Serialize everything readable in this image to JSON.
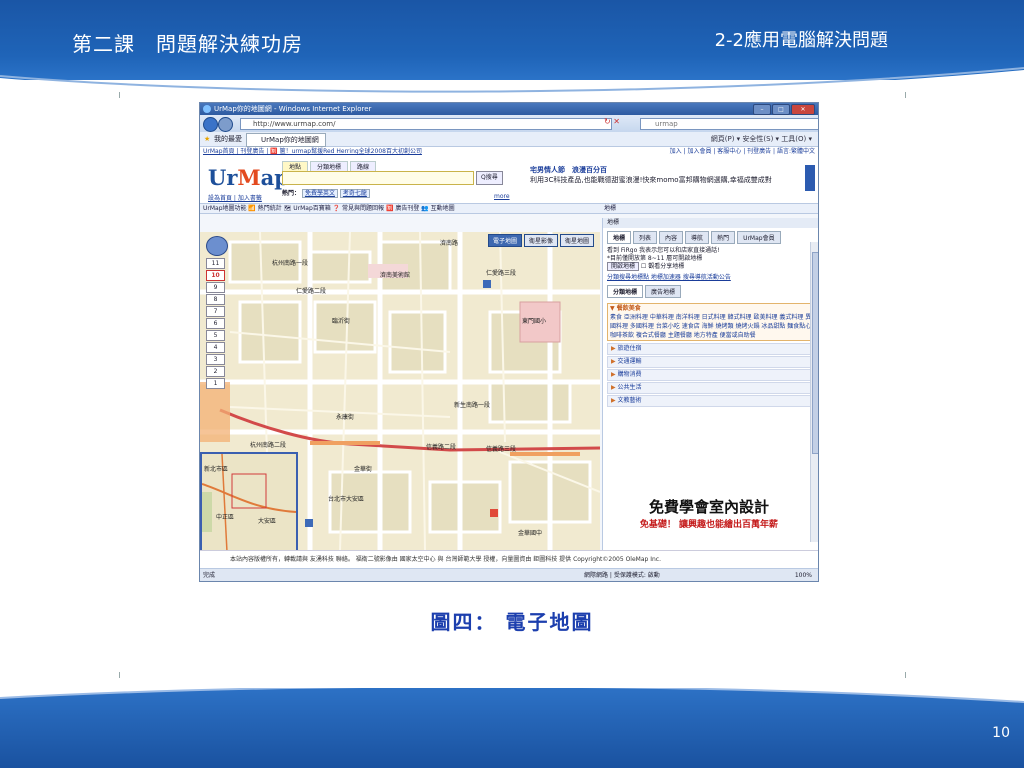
{
  "slide": {
    "lesson_title": "第二課　問題解決練功房",
    "section_title": "2-2應用電腦解決問題",
    "caption": "圖四：  電子地圖",
    "page_number": "10",
    "colors": {
      "header_blue": "#1f64b8",
      "caption_blue": "#1c3fae"
    }
  },
  "browser": {
    "window_title": "UrMap你的地圖網 - Windows Internet Explorer",
    "address": "http://www.urmap.com/",
    "search_placeholder": "urmap",
    "favorites_label": "我的最愛",
    "tab_title": "UrMap你的地圖網",
    "toolbar_right": "網頁(P) ▾  安全性(S) ▾  工具(O) ▾",
    "status_done": "完成",
    "status_zone": "網際網路 | 受保護模式: 啟動",
    "zoom_level": "100%"
  },
  "site": {
    "links_left": "UrMap首頁 | 刊登廣告 | 🈹 篋！urmap幫援Red Herring全球2008百大初創公司",
    "links_right": "加入 | 加入會員 | 客服中心 | 刊登廣告 | 語言:繁體中文",
    "logo_prefix": "Ur",
    "logo_accent": "M",
    "logo_suffix": "ap",
    "logo_links": "設為首頁 | 加入書籤",
    "search_tabs": [
      "地點",
      "分類地標",
      "路線"
    ],
    "search_button": "Q搜尋",
    "hot_label": "熱門：",
    "hot_1": "免費學英文",
    "hot_2": "考奇七龍",
    "more_link": "more",
    "ad_title": "宅男情人節　浪漫百分百",
    "ad_text": "利用3C科技產品,也能戰德甜蜜浪漫!快來momo富邦購物網選購,幸福成雙成對",
    "map_toolbar": "UrMap地圖功能  📶 熱門統計  🗺 UrMap百寶箱  ❓ 常見與問題回報  🈹 廣告刊登  👥 互動地圖",
    "map_toolbar_right": "地標",
    "copyright": "本站內容版權所有，轉載請與 友湧科技 聯絡。  福衛二號影像由 國家太空中心 與 台灣師範大學 授權，向量圖資由 鉅圖科技 提供 Copyright©2005 OleMap Inc."
  },
  "map": {
    "view_tabs": [
      "電子地圖",
      "衛星影像",
      "衛星地圖"
    ],
    "zoom_levels": [
      "11",
      "10",
      "9",
      "8",
      "7",
      "6",
      "5",
      "4",
      "3",
      "2",
      "1"
    ],
    "active_zoom": "10",
    "labels": {
      "road1": "杭州南路一段",
      "road2": "仁愛路二段",
      "road3": "仁愛路三段",
      "road4": "新生南路一段",
      "road5": "信義路二段",
      "road6": "信義路三段",
      "road7": "杭州南路二段",
      "road8": "金華街",
      "road9": "永康街",
      "place1": "濟南路",
      "place2": "臨沂街",
      "place3": "東門國小",
      "place4": "金華國中",
      "place5": "台北市大安區",
      "place6": "中正區",
      "place7": "大安區",
      "place8": "新北市區",
      "place9": "濟南美術館"
    }
  },
  "panel": {
    "title": "地標",
    "tabs": [
      "地標",
      "列表",
      "內容",
      "導航",
      "熱門",
      "UrMap會員"
    ],
    "line1": "看到 FiRgo 我表示您可以和店家直接通話!",
    "line2": "*目前僅開放第 8~11 層可開啟地標",
    "btn_open": "開啟地標",
    "check_share": "觀看分享地標",
    "link_row": "分類搜尋地標點   地標加速器   搜尋導航活動公告",
    "sub_tabs": [
      "分類地標",
      "廣告地標"
    ],
    "food_head": "▼ 餐飲美食",
    "food_items": "素食  亞洲料理  中華料理  南洋料理  日式料理  韓式料理  歐美料理  義式料理  異國料理  多國料理  台菜小吃  速食店  海鮮  燒烤類  燒烤火鍋  冰品甜點  麵食點心  咖啡茶飲  複合式餐廳  主題餐廳  地方特產  便當或自助餐",
    "categories": [
      "旅遊住宿",
      "交通運輸",
      "購物消費",
      "公共生活",
      "文教藝術"
    ],
    "ad_line1": "免費學會室內設計",
    "ad_line2": "免基礎！ 讓興趣也能繪出百萬年薪"
  }
}
